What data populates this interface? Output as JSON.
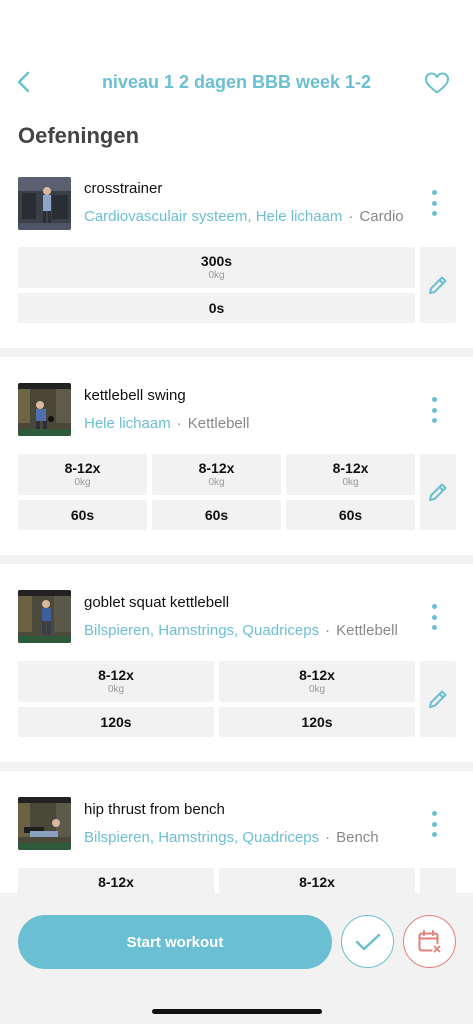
{
  "header": {
    "title": "niveau 1 2 dagen BBB week 1-2",
    "section_title": "Oefeningen"
  },
  "exercises": [
    {
      "name": "crosstrainer",
      "tags": "Cardiovasculair systeem, Hele lichaam",
      "equipment": "Cardio",
      "sets": [
        {
          "reps": "300s",
          "weight": "0kg",
          "rest": "0s"
        }
      ]
    },
    {
      "name": "kettlebell swing",
      "tags": "Hele lichaam",
      "equipment": "Kettlebell",
      "sets": [
        {
          "reps": "8-12x",
          "weight": "0kg",
          "rest": "60s"
        },
        {
          "reps": "8-12x",
          "weight": "0kg",
          "rest": "60s"
        },
        {
          "reps": "8-12x",
          "weight": "0kg",
          "rest": "60s"
        }
      ]
    },
    {
      "name": "goblet squat kettlebell",
      "tags": "Bilspieren, Hamstrings, Quadriceps",
      "equipment": "Kettlebell",
      "sets": [
        {
          "reps": "8-12x",
          "weight": "0kg",
          "rest": "120s"
        },
        {
          "reps": "8-12x",
          "weight": "0kg",
          "rest": "120s"
        }
      ]
    },
    {
      "name": "hip thrust from bench",
      "tags": "Bilspieren, Hamstrings, Quadriceps",
      "equipment": "Bench",
      "sets": [
        {
          "reps": "8-12x"
        },
        {
          "reps": "8-12x"
        }
      ]
    }
  ],
  "footer": {
    "start_label": "Start workout"
  },
  "icons": {
    "back": "chevron-left-icon",
    "favorite": "heart-outline-icon",
    "more": "vertical-dots-icon",
    "edit": "pencil-icon",
    "complete": "checkmark-icon",
    "skip": "calendar-x-icon"
  },
  "colors": {
    "accent": "#6bbfd2",
    "danger": "#e2807a",
    "background": "#f2f2f2",
    "muted_text": "#888888"
  }
}
